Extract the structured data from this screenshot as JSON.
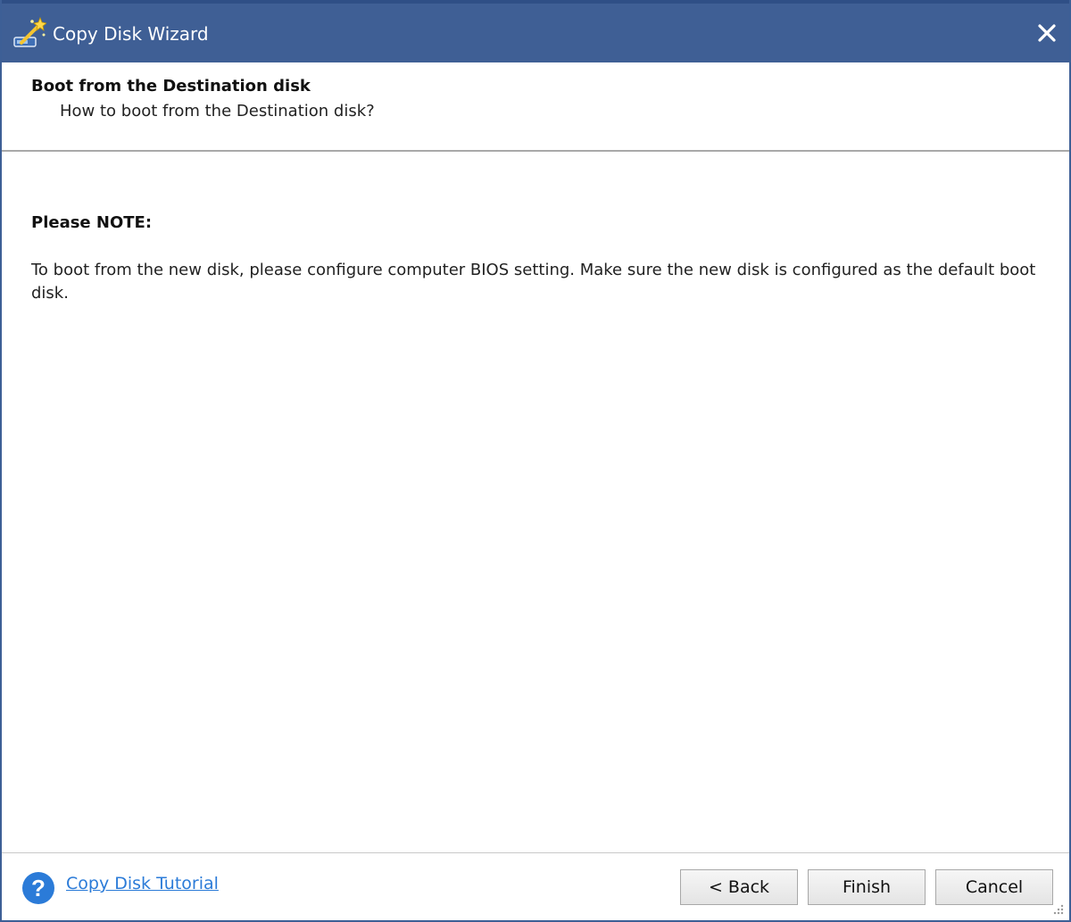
{
  "window": {
    "title": "Copy Disk Wizard",
    "title_color": "#3f5f95"
  },
  "header": {
    "title": "Boot from the Destination disk",
    "subtitle": "How to boot from the Destination disk?"
  },
  "note": {
    "title": "Please NOTE:",
    "body": "To boot from the new disk, please configure computer BIOS setting. Make sure the new disk is configured as the default boot disk."
  },
  "footer": {
    "tutorial_link": "Copy Disk Tutorial",
    "link_color": "#2b7bd8",
    "back_label": "< Back",
    "finish_label": "Finish",
    "cancel_label": "Cancel"
  },
  "icons": {
    "app": "wizard-wand-icon",
    "close": "close-icon",
    "help": "question-mark-icon",
    "resize": "resize-grip-icon"
  }
}
